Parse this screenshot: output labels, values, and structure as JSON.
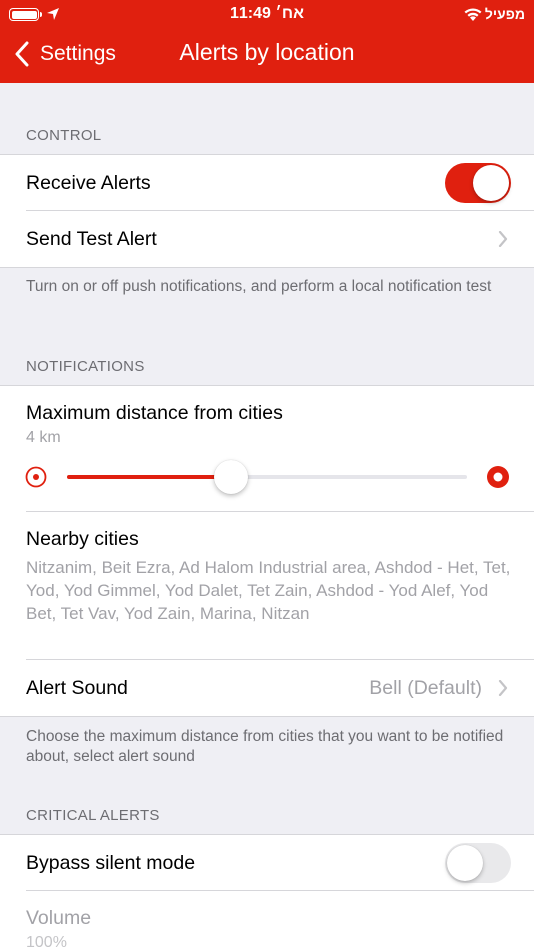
{
  "status_bar": {
    "time": "11:49",
    "day": "אח׳",
    "carrier": "מפעיל"
  },
  "nav": {
    "back_label": "Settings",
    "title": "Alerts by location"
  },
  "colors": {
    "accent": "#e0200f",
    "secondary_text": "#a2a2a7",
    "section_text": "#6d6d72",
    "background": "#efeff4"
  },
  "control": {
    "section_label": "CONTROL",
    "receive_alerts": {
      "label": "Receive Alerts",
      "on": true
    },
    "send_test_alert": {
      "label": "Send Test Alert"
    },
    "footer": "Turn on or off push notifications, and perform a local notification test"
  },
  "notifications": {
    "section_label": "NOTIFICATIONS",
    "max_distance": {
      "label": "Maximum distance from cities",
      "value_text": "4 km",
      "slider_fraction": 0.41
    },
    "nearby_cities": {
      "label": "Nearby cities",
      "value": "Nitzanim, Beit Ezra, Ad Halom Industrial area, Ashdod - Het, Tet, Yod, Yod Gimmel, Yod Dalet, Tet Zain, Ashdod - Yod Alef, Yod Bet, Tet Vav, Yod Zain, Marina, Nitzan"
    },
    "alert_sound": {
      "label": "Alert Sound",
      "value": "Bell (Default)"
    },
    "footer": "Choose the maximum distance from cities that you want to be notified about, select alert sound"
  },
  "critical_alerts": {
    "section_label": "CRITICAL ALERTS",
    "bypass_silent": {
      "label": "Bypass silent mode",
      "on": false
    },
    "volume": {
      "label": "Volume",
      "value": "100%"
    }
  }
}
